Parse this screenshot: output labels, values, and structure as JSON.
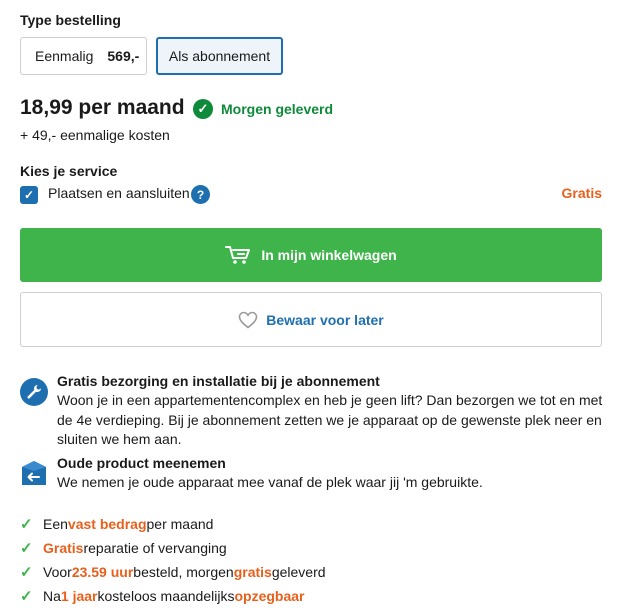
{
  "order_type": {
    "title": "Type bestelling",
    "one_time_label": "Eenmalig",
    "one_time_price": "569,-",
    "subscription_label": "Als abonnement"
  },
  "pricing": {
    "monthly": "18,99 per maand",
    "delivery": "Morgen geleverd",
    "one_time_costs": "+ 49,- eenmalige kosten"
  },
  "service": {
    "title": "Kies je service",
    "option_label": "Plaatsen en aansluiten",
    "option_price": "Gratis",
    "help_symbol": "?"
  },
  "actions": {
    "cart_label": "In mijn winkelwagen",
    "save_label": "Bewaar voor later"
  },
  "features": [
    {
      "icon": "wrench-icon",
      "title": "Gratis bezorging en installatie bij je abonnement",
      "text": "Woon je in een appartementencomplex en heb je geen lift? Dan bezorgen we tot en met de 4e verdieping. Bij je abonnement zetten we je apparaat op de gewenste plek neer en sluiten we hem aan."
    },
    {
      "icon": "return-box-icon",
      "title": "Oude product meenemen",
      "text": "We nemen je oude apparaat mee vanaf de plek waar jij 'm gebruikte."
    }
  ],
  "usps": {
    "u1": {
      "a": "Een ",
      "b": "vast bedrag",
      "c": " per maand"
    },
    "u2": {
      "a": "Gratis",
      "b": " reparatie of vervanging"
    },
    "u3": {
      "a": "Voor ",
      "b": "23.59 uur",
      "c": " besteld, morgen ",
      "d": "gratis",
      "e": " geleverd"
    },
    "u4": {
      "a": "Na ",
      "b": "1 jaar",
      "c": " kosteloos maandelijks ",
      "d": "opzegbaar"
    }
  },
  "colors": {
    "accent_green": "#3eb44a",
    "delivery_green": "#0f8a3a",
    "brand_blue": "#1e6fb0",
    "highlight_orange": "#e8601c"
  }
}
